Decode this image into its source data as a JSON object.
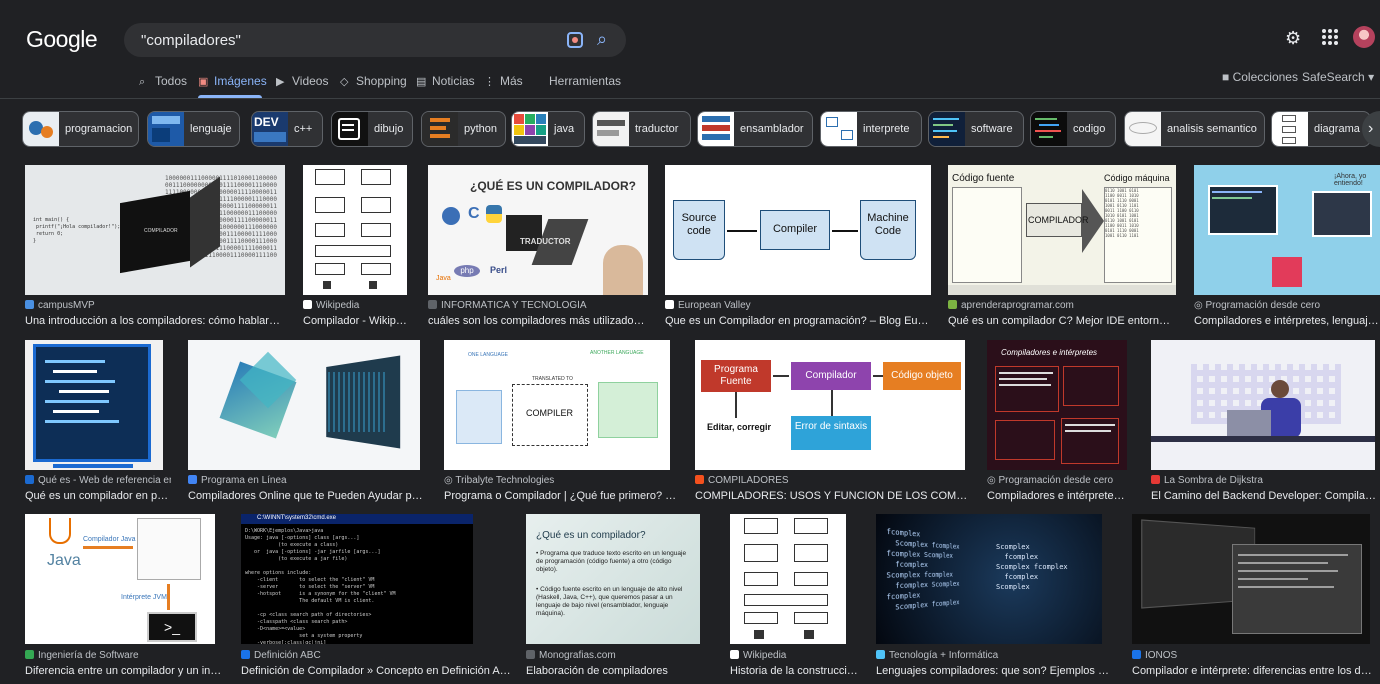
{
  "header": {
    "logo": "Google",
    "query": "\"compiladores\""
  },
  "tabs": [
    {
      "label": "Todos",
      "icon": "search-icon"
    },
    {
      "label": "Imágenes",
      "icon": "image-icon"
    },
    {
      "label": "Videos",
      "icon": "video-icon"
    },
    {
      "label": "Shopping",
      "icon": "tag-icon"
    },
    {
      "label": "Noticias",
      "icon": "news-icon"
    },
    {
      "label": "Más",
      "icon": "more-icon"
    },
    {
      "label": "Herramientas"
    }
  ],
  "right_tools": {
    "collections": "Colecciones",
    "safesearch": "SafeSearch"
  },
  "chips": [
    {
      "label": "programacion"
    },
    {
      "label": "lenguaje"
    },
    {
      "label": "c++"
    },
    {
      "label": "dibujo"
    },
    {
      "label": "python"
    },
    {
      "label": "java"
    },
    {
      "label": "traductor"
    },
    {
      "label": "ensamblador"
    },
    {
      "label": "interprete"
    },
    {
      "label": "software"
    },
    {
      "label": "codigo"
    },
    {
      "label": "analisis semantico"
    },
    {
      "label": "diagrama"
    }
  ],
  "results": [
    {
      "source": "campusMVP",
      "title": "Una introducción a los compiladores: cómo hablar con una co..."
    },
    {
      "source": "Wikipedia",
      "title": "Compilador - Wikipedia, l..."
    },
    {
      "source": "INFORMÁTICA Y TECNOLOGÍA",
      "title": "cuáles son los compiladores más utilizados en el mu..."
    },
    {
      "source": "European Valley",
      "title": "Que es un Compilador en programación? – Blog Europeanvalley"
    },
    {
      "source": "aprenderaprogramar.com",
      "title": "Qué es un compilador C? Mejor IDE entorno de desarro..."
    },
    {
      "source": "Programación desde cero",
      "title": "Compiladores e intérpretes, lenguajes compil..."
    },
    {
      "source": "Qué es - Web de referencia en ...",
      "title": "Qué es un compilador en program..."
    },
    {
      "source": "Programa en Línea",
      "title": "Compiladores Online que te Pueden Ayudar para la Progr..."
    },
    {
      "source": "Tribalyte Technologies",
      "title": "Programa o Compilador | ¿Qué fue primero? ¿Quién lo in..."
    },
    {
      "source": "COMPILADORES",
      "title": "COMPILADORES: USOS Y FUNCION DE LOS COMPILADORES"
    },
    {
      "source": "Programación desde cero",
      "title": "Compiladores e intérpretes - Prog..."
    },
    {
      "source": "La Sombra de Dijkstra",
      "title": "El Camino del Backend Developer: Compiladores e Intér..."
    },
    {
      "source": "Ingeniería de Software",
      "title": "Diferencia entre un compilador y un intérprete? ..."
    },
    {
      "source": "Definición ABC",
      "title": "Definición de Compilador » Concepto en Definición ABC"
    },
    {
      "source": "Monografias.com",
      "title": "Elaboración de compiladores"
    },
    {
      "source": "Wikipedia",
      "title": "Historia de la construcción de..."
    },
    {
      "source": "Tecnología + Informática",
      "title": "Lenguajes compiladores: que son? Ejemplos - Tecnología..."
    },
    {
      "source": "IONOS",
      "title": "Compilador e intérprete: diferencias entre los dos programas..."
    }
  ],
  "image_text": {
    "que_es_compilador": "¿QUÉ ES UN COMPILADOR?",
    "traductor": "TRADUCTOR",
    "source_code": "Source code",
    "compiler": "Compiler",
    "machine_code": "Machine Code",
    "codigo_fuente": "Código fuente",
    "codigo_maquina": "Código máquina",
    "compilador_caps": "COMPILADOR",
    "one_language": "ONE LANGUAGE",
    "another_language": "ANOTHER LANGUAGE",
    "translated_to": "TRANSLATED TO",
    "compiler_caps": "COMPILER",
    "programa_fuente": "Programa Fuente",
    "compilador": "Compilador",
    "codigo_objeto": "Código objeto",
    "error_sintaxis": "Error de sintaxis",
    "editar_corregir": "Editar, corregir",
    "compiladores_interpretes": "Compiladores e intérpretes",
    "compilador_java": "Compilador Java",
    "interprete_jvm": "Intérprete JVM",
    "java": "Java",
    "que_es_un_compilador": "¿Qué es un compilador?",
    "bullet1": "Programa que traduce texto escrito en un lenguaje de programación (código fuente) a otro (código objeto).",
    "bullet2": "Código fuente escrito en un lenguaje de alto nivel (Haskell, Java, C++), que queremos pasar a un lenguaje de bajo nivel (ensamblador, lenguaje máquina).",
    "prompt": ">_",
    "cmd_title": "C:\\WINNT\\system32\\cmd.exe"
  },
  "colors": {
    "background": "#202124",
    "link_blue": "#8ab4f8",
    "text": "#e8eaed",
    "muted": "#bdc1c6"
  }
}
